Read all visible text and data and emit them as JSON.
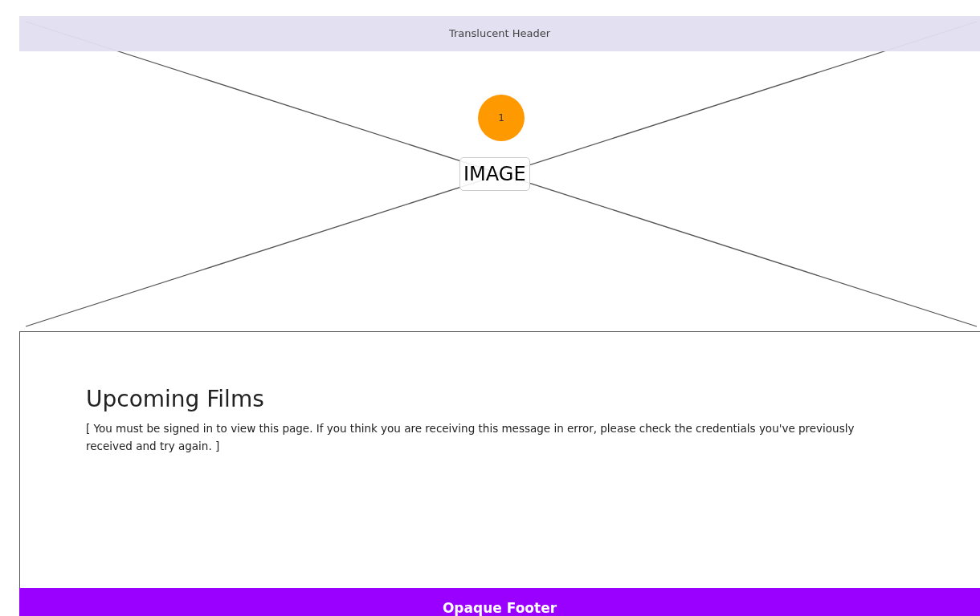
{
  "header": {
    "title": "Translucent Header"
  },
  "image": {
    "label": "IMAGE",
    "badge": "1"
  },
  "content": {
    "heading": "Upcoming Films",
    "message": "[ You must be signed in to view this page. If you think you are receiving this message in error, please check the credentials you've previously received and try again. ]"
  },
  "footer": {
    "title": "Opaque Footer"
  }
}
